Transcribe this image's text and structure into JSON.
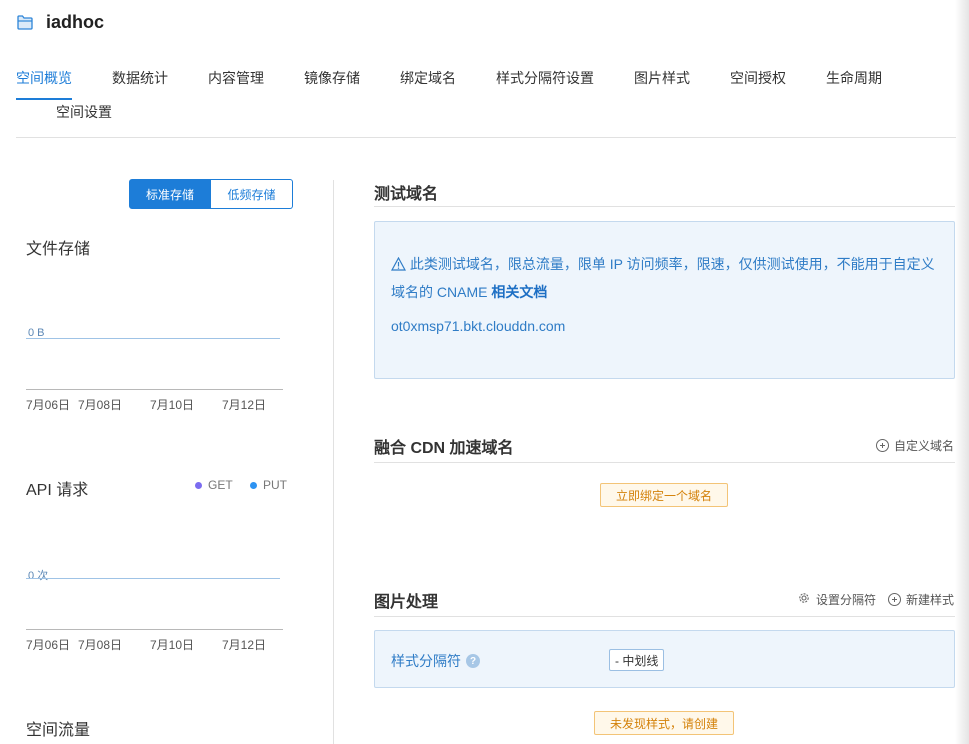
{
  "bucket": {
    "name": "iadhoc",
    "icon": "bucket-icon"
  },
  "tabs": [
    {
      "label": "空间概览",
      "active": true
    },
    {
      "label": "数据统计"
    },
    {
      "label": "内容管理"
    },
    {
      "label": "镜像存储"
    },
    {
      "label": "绑定域名"
    },
    {
      "label": "样式分隔符设置"
    },
    {
      "label": "图片样式"
    },
    {
      "label": "空间授权"
    },
    {
      "label": "生命周期"
    },
    {
      "label": "空间设置"
    }
  ],
  "storage_toggle": {
    "standard": "标准存储",
    "infrequent": "低频存储",
    "selected": "标准存储"
  },
  "file_storage": {
    "title": "文件存储",
    "zero_label": "0 B",
    "ticks": [
      "7月06日",
      "7月08日",
      "7月10日",
      "7月12日"
    ]
  },
  "api_requests": {
    "title": "API 请求",
    "legend": [
      {
        "name": "GET",
        "color": "#7b6cf0"
      },
      {
        "name": "PUT",
        "color": "#2d93f2"
      }
    ],
    "zero_label": "0 次",
    "ticks": [
      "7月06日",
      "7月08日",
      "7月10日",
      "7月12日"
    ]
  },
  "space_traffic": {
    "title": "空间流量"
  },
  "test_domain": {
    "title": "测试域名",
    "warning_icon": "warning-icon",
    "warning_text": "此类测试域名，限总流量，限单 IP 访问频率，限速，仅供测试使用，不能用于自定义域名的 CNAME",
    "doc_link": "相关文档",
    "domain": "ot0xmsp71.bkt.clouddn.com"
  },
  "cdn_domain": {
    "title": "融合 CDN 加速域名",
    "custom_action": "自定义域名",
    "bind_button": "立即绑定一个域名"
  },
  "image_processing": {
    "title": "图片处理",
    "separator_action": "设置分隔符",
    "new_style_action": "新建样式",
    "separator_label": "样式分隔符",
    "separator_value": "- 中划线",
    "empty_button": "未发现样式，请创建"
  },
  "colors": {
    "accent": "#1d7dd8",
    "warning": "#d4820b",
    "info_bg": "#eef5fc"
  }
}
